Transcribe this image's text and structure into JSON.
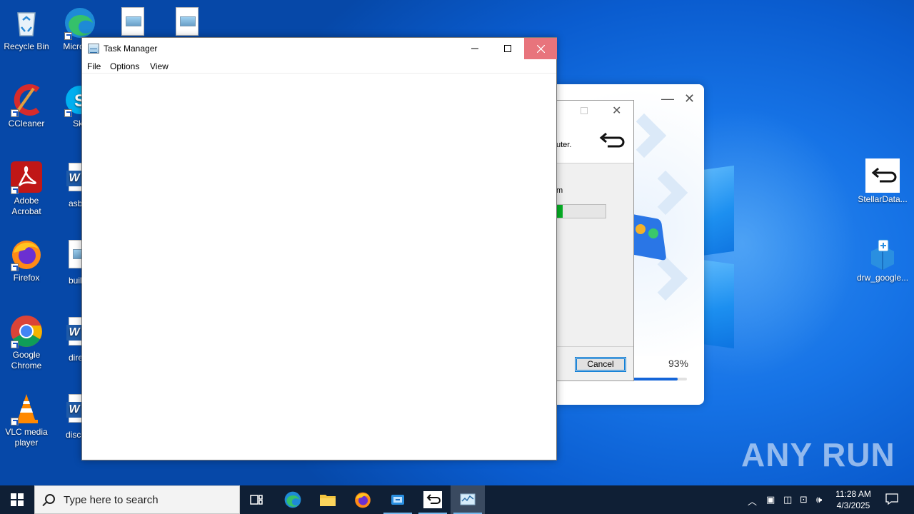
{
  "desktop": {
    "icons_left": [
      {
        "label": "Recycle Bin"
      },
      {
        "label": "CCleaner"
      },
      {
        "label": "Adobe Acrobat"
      },
      {
        "label": "Firefox"
      },
      {
        "label": "Google Chrome"
      },
      {
        "label": "VLC media player"
      }
    ],
    "icons_col2": [
      {
        "label": "Micro Ed"
      },
      {
        "label": "Sky"
      },
      {
        "label": "asbac"
      },
      {
        "label": "builde"
      },
      {
        "label": "directi"
      },
      {
        "label": "discuss"
      }
    ],
    "icons_right": [
      {
        "label": "StellarData..."
      },
      {
        "label": "drw_google..."
      }
    ],
    "watermark": "ANY RUN"
  },
  "installer": {
    "percent_label": "93%",
    "progress": 0.93
  },
  "setup_dialog": {
    "text_line1": "uter.",
    "text_line2": "m",
    "progress": 0.12,
    "cancel_label": "Cancel"
  },
  "task_manager": {
    "title": "Task Manager",
    "menu": [
      "File",
      "Options",
      "View"
    ]
  },
  "taskbar": {
    "search_placeholder": "Type here to search",
    "time": "11:28 AM",
    "date": "4/3/2025"
  },
  "colors": {
    "desktop_blue": "#0a62d6",
    "taskbar": "#0f1f35",
    "close_hover": "#e8747c",
    "progress_green": "#06b025",
    "progress_blue": "#1565d8"
  }
}
